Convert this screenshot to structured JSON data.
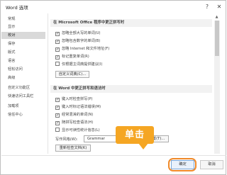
{
  "window": {
    "title": "Word 选项",
    "help": "?",
    "close": "✕"
  },
  "sidebar": {
    "items": [
      {
        "label": "常规"
      },
      {
        "label": "显示"
      },
      {
        "label": "校对",
        "active": true
      },
      {
        "label": "保存"
      },
      {
        "label": "版式"
      },
      {
        "label": "语言"
      },
      {
        "label": "轻松访问"
      },
      {
        "label": "高级"
      },
      {
        "label": "自定义功能区"
      },
      {
        "label": "快速访问工具栏"
      },
      {
        "label": "加载项"
      },
      {
        "label": "信任中心"
      }
    ]
  },
  "office_section": {
    "title": "在 Microsoft Office 程序中更正拼写时",
    "options": [
      {
        "label": "忽略全部大写的单词(U)",
        "checked": true
      },
      {
        "label": "忽略包含数字的单词(B)",
        "checked": true
      },
      {
        "label": "忽略 Internet 和文件地址(F)",
        "checked": true
      },
      {
        "label": "标记重复单词(R)",
        "checked": true
      },
      {
        "label": "仅根据主词典提供建议(I)",
        "checked": false
      }
    ],
    "custom_dict_button": "自定义词典(C)..."
  },
  "word_section": {
    "title": "在 Word 中更正拼写和语法时",
    "options": [
      {
        "label": "键入时检查拼写(P)",
        "checked": true
      },
      {
        "label": "键入时标记语法错误(M)",
        "checked": true
      },
      {
        "label": "经常混淆的单词(N)",
        "checked": true
      },
      {
        "label": "随拼写检查语法(H)",
        "checked": true
      },
      {
        "label": "显示可读性统计信息(L)",
        "checked": false
      }
    ],
    "writing_style_label": "写作风格(W):",
    "writing_style_value": "Grammar",
    "settings_button": "设置(T)...",
    "recheck_button": "重新检查文档(K)"
  },
  "annotation": {
    "callout_text": "单击"
  },
  "footer": {
    "ok_label": "确定",
    "cancel_label": "取消"
  },
  "colors": {
    "callout": "#f5a623",
    "highlight_border": "#f08a2a",
    "ok_border": "#7aa7d8"
  }
}
